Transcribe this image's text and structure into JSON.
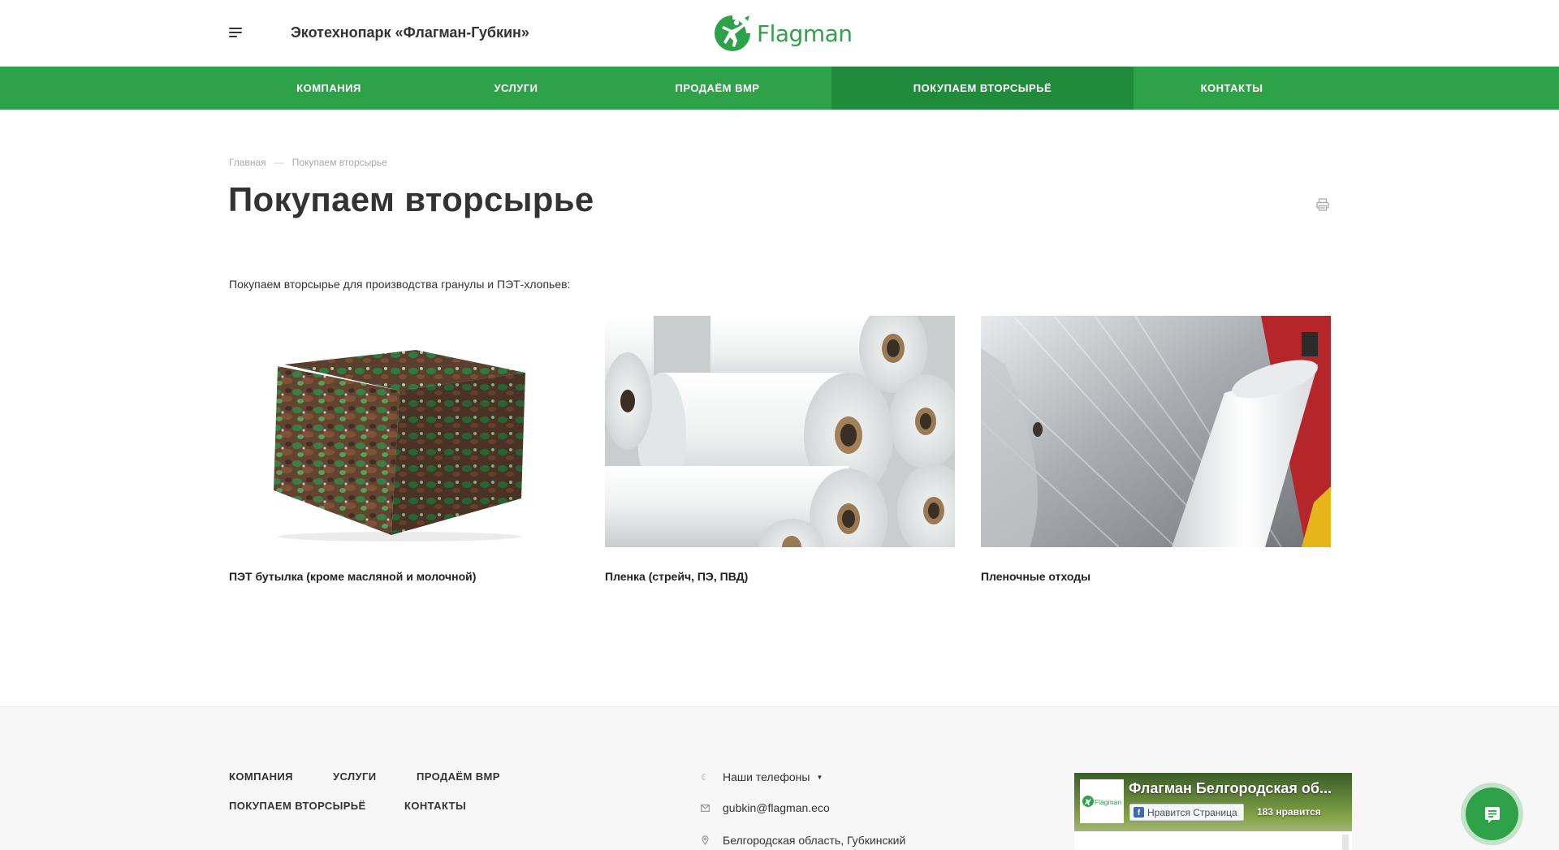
{
  "header": {
    "site_name": "Экотехнопарк «Флагман-Губкин»",
    "logo_text": "Flagman"
  },
  "nav": {
    "items": [
      {
        "label": "Компания"
      },
      {
        "label": "Услуги"
      },
      {
        "label": "Продаём ВМР"
      },
      {
        "label": "Покупаем вторсырьё",
        "active": true
      },
      {
        "label": "Контакты"
      }
    ]
  },
  "breadcrumb": {
    "home": "Главная",
    "separator": "—",
    "current": "Покупаем вторсырье"
  },
  "page": {
    "title": "Покупаем вторсырье",
    "intro": "Покупаем вторсырье для производства гранулы и ПЭТ-хлопьев:"
  },
  "cards": [
    {
      "title": "ПЭТ бутылка (кроме масляной и молочной)",
      "image": "pet-bottle-bale"
    },
    {
      "title": "Пленка (стрейч, ПЭ, ПВД)",
      "image": "film-rolls"
    },
    {
      "title": "Пленочные отходы",
      "image": "film-waste"
    }
  ],
  "footer": {
    "menu": [
      {
        "label": "Компания"
      },
      {
        "label": "Услуги"
      },
      {
        "label": "Продаём ВМР"
      },
      {
        "label": "Покупаем вторсырьё"
      },
      {
        "label": "Контакты"
      }
    ],
    "phones_label": "Наши телефоны",
    "email": "gubkin@flagman.eco",
    "address": "Белгородская область, Губкинский"
  },
  "facebook_widget": {
    "page_title": "Флагман Белгородская об...",
    "like_label": "Нравится Страница",
    "likes": "183 нравится",
    "logo_text": "Flagman"
  },
  "colors": {
    "brand_green": "#2ea248",
    "nav_active": "#208c3b"
  }
}
